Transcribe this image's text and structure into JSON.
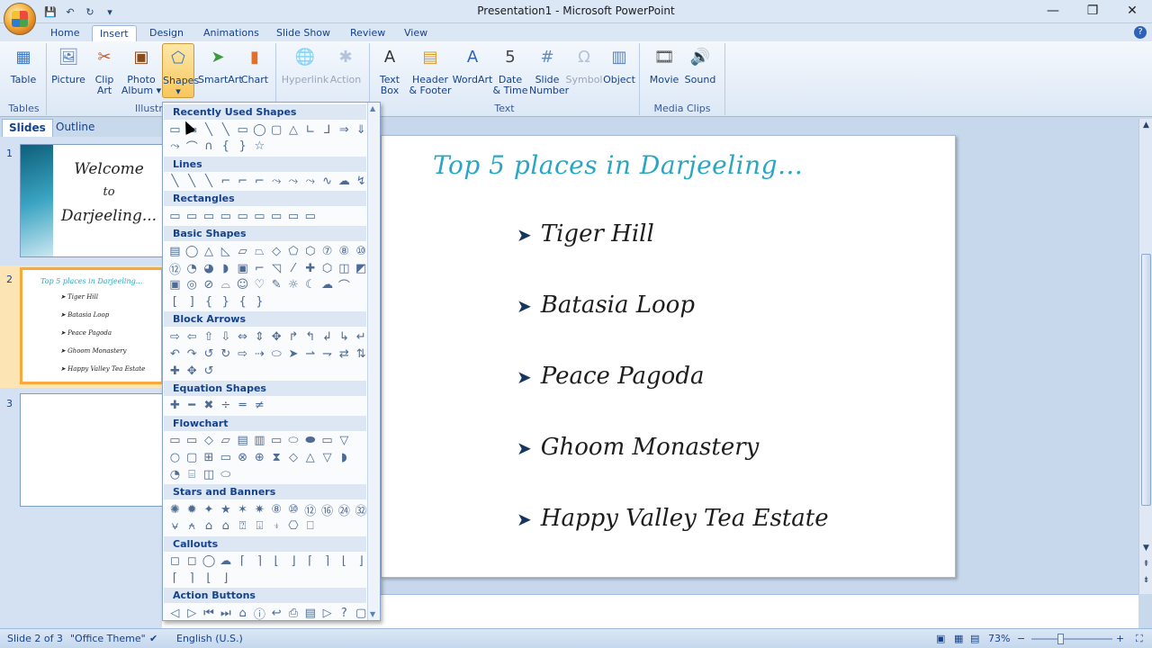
{
  "window": {
    "title": "Presentation1 - Microsoft PowerPoint",
    "minimize": "—",
    "restore": "❐",
    "close": "✕"
  },
  "qat": {
    "save": "💾",
    "undo": "↶",
    "redo": "↻",
    "more": "▾"
  },
  "tabs": [
    "Home",
    "Insert",
    "Design",
    "Animations",
    "Slide Show",
    "Review",
    "View"
  ],
  "active_tab": "Insert",
  "help_icon": "?",
  "ribbon": {
    "groups": [
      {
        "label": "Tables"
      },
      {
        "label": "Illustrations"
      },
      {
        "label": "Text"
      },
      {
        "label": "Media Clips"
      }
    ],
    "buttons": [
      {
        "line1": "Table",
        "line2": "",
        "icon": "▦",
        "color": "#3a78c8",
        "state": "normal"
      },
      {
        "line1": "Picture",
        "line2": "",
        "icon": "🖼",
        "color": "#5b7fb7",
        "state": "normal"
      },
      {
        "line1": "Clip",
        "line2": "Art",
        "icon": "✂",
        "color": "#c65a2a",
        "state": "normal"
      },
      {
        "line1": "Photo",
        "line2": "Album ▾",
        "icon": "▣",
        "color": "#8a4a1a",
        "state": "normal"
      },
      {
        "line1": "Shapes",
        "line2": "▾",
        "icon": "⬠",
        "color": "#3a78c8",
        "state": "pressed"
      },
      {
        "line1": "SmartArt",
        "line2": "",
        "icon": "➤",
        "color": "#3d9a3d",
        "state": "normal"
      },
      {
        "line1": "Chart",
        "line2": "",
        "icon": "▮",
        "color": "#e0702a",
        "state": "normal"
      },
      {
        "line1": "Hyperlink",
        "line2": "",
        "icon": "🌐",
        "color": "#6a88b4",
        "state": "disabled"
      },
      {
        "line1": "Action",
        "line2": "",
        "icon": "✱",
        "color": "#6a88b4",
        "state": "disabled"
      },
      {
        "line1": "Text",
        "line2": "Box",
        "icon": "A",
        "color": "#333333",
        "state": "normal"
      },
      {
        "line1": "Header",
        "line2": "& Footer",
        "icon": "▤",
        "color": "#d79a2a",
        "state": "normal"
      },
      {
        "line1": "WordArt",
        "line2": "",
        "icon": "A",
        "color": "#2f62b6",
        "state": "normal"
      },
      {
        "line1": "Date",
        "line2": "& Time",
        "icon": "5",
        "color": "#444444",
        "state": "normal"
      },
      {
        "line1": "Slide",
        "line2": "Number",
        "icon": "#",
        "color": "#6a88b4",
        "state": "normal"
      },
      {
        "line1": "Symbol",
        "line2": "",
        "icon": "Ω",
        "color": "#6a88b4",
        "state": "disabled"
      },
      {
        "line1": "Object",
        "line2": "",
        "icon": "▥",
        "color": "#5b7fb7",
        "state": "normal"
      },
      {
        "line1": "Movie",
        "line2": "",
        "icon": "🎞",
        "color": "#555555",
        "state": "normal"
      },
      {
        "line1": "Sound",
        "line2": "",
        "icon": "🔊",
        "color": "#d79a2a",
        "state": "normal"
      }
    ]
  },
  "side_tabs": [
    "Slides",
    "Outline"
  ],
  "thumbnails": {
    "numbers": [
      "1",
      "2",
      "3"
    ],
    "slide1": [
      "Welcome",
      "to",
      "Darjeeling..."
    ],
    "slide2_title": "Top 5 places in Darjeeling...",
    "slide2_items": [
      "Tiger Hill",
      "Batasia Loop",
      "Peace Pagoda",
      "Ghoom Monastery",
      "Happy Valley Tea Estate"
    ]
  },
  "slide": {
    "title": "Top 5 places in Darjeeling...",
    "bullets": [
      "Tiger Hill",
      "Batasia Loop",
      "Peace Pagoda",
      "Ghoom Monastery",
      "Happy Valley Tea Estate"
    ],
    "bullet_icon": "➤"
  },
  "gallery": {
    "sections": [
      {
        "name": "Recently Used Shapes",
        "rows": [
          [
            "▭",
            "▭",
            "╲",
            "╲",
            "▭",
            "◯",
            "▢",
            "△",
            "∟",
            "⅃",
            "⇒",
            "⇓",
            "☁"
          ],
          [
            "⤳",
            "⌒",
            "∩",
            "{",
            "}",
            "☆"
          ]
        ]
      },
      {
        "name": "Lines",
        "rows": [
          [
            "╲",
            "╲",
            "╲",
            "⌐",
            "⌐",
            "⌐",
            "⤳",
            "⤳",
            "⤳",
            "∿",
            "☁",
            "↯"
          ]
        ]
      },
      {
        "name": "Rectangles",
        "rows": [
          [
            "▭",
            "▭",
            "▭",
            "▭",
            "▭",
            "▭",
            "▭",
            "▭",
            "▭"
          ]
        ]
      },
      {
        "name": "Basic Shapes",
        "rows": [
          [
            "▤",
            "◯",
            "△",
            "◺",
            "▱",
            "⏢",
            "◇",
            "⬠",
            "⬡",
            "⑦",
            "⑧",
            "⑩"
          ],
          [
            "⑫",
            "◔",
            "◕",
            "◗",
            "▣",
            "⌐",
            "◹",
            "⁄",
            "✚",
            "⬡",
            "◫",
            "◩"
          ],
          [
            "▣",
            "◎",
            "⊘",
            "⌓",
            "☺",
            "♡",
            "✎",
            "☼",
            "☾",
            "☁",
            "⌒"
          ],
          [
            "[",
            "]",
            "{",
            "}",
            "{",
            "}"
          ]
        ]
      },
      {
        "name": "Block Arrows",
        "rows": [
          [
            "⇨",
            "⇦",
            "⇧",
            "⇩",
            "⇔",
            "⇕",
            "✥",
            "↱",
            "↰",
            "↲",
            "↳",
            "↵"
          ],
          [
            "↶",
            "↷",
            "↺",
            "↻",
            "⇨",
            "⇢",
            "⬭",
            "➤",
            "⇀",
            "⇁",
            "⇄",
            "⇅"
          ],
          [
            "✚",
            "✥",
            "↺"
          ]
        ]
      },
      {
        "name": "Equation Shapes",
        "rows": [
          [
            "✚",
            "━",
            "✖",
            "÷",
            "═",
            "≠"
          ]
        ]
      },
      {
        "name": "Flowchart",
        "rows": [
          [
            "▭",
            "▭",
            "◇",
            "▱",
            "▤",
            "▥",
            "▭",
            "⬭",
            "⬬",
            "▭",
            "▽"
          ],
          [
            "○",
            "▢",
            "⊞",
            "▭",
            "⊗",
            "⊕",
            "⧗",
            "◇",
            "△",
            "▽",
            "◗"
          ],
          [
            "◔",
            "⌸",
            "◫",
            "⬭"
          ]
        ]
      },
      {
        "name": "Stars and Banners",
        "rows": [
          [
            "✺",
            "✹",
            "✦",
            "★",
            "✶",
            "✷",
            "⑧",
            "⑩",
            "⑫",
            "⑯",
            "㉔",
            "㉜"
          ],
          [
            "⍱",
            "⍲",
            "⌂",
            "⌂",
            "⍰",
            "⍗",
            "⍖",
            "⎔",
            "⎕"
          ]
        ]
      },
      {
        "name": "Callouts",
        "rows": [
          [
            "◻",
            "◻",
            "◯",
            "☁",
            "⌈",
            "⌉",
            "⌊",
            "⌋",
            "⌈",
            "⌉",
            "⌊",
            "⌋"
          ],
          [
            "⌈",
            "⌉",
            "⌊",
            "⌋"
          ]
        ]
      },
      {
        "name": "Action Buttons",
        "rows": [
          [
            "◁",
            "▷",
            "⏮",
            "⏭",
            "⌂",
            "ⓘ",
            "↩",
            "⎙",
            "▤",
            "▷",
            "?",
            "▢"
          ]
        ]
      }
    ]
  },
  "status": {
    "slide": "Slide 2 of 3",
    "theme": "\"Office Theme\"",
    "language": "English (U.S.)",
    "zoom": "73%",
    "zoom_minus": "−",
    "zoom_plus": "+"
  },
  "scroll": {
    "up": "▲",
    "down": "▼",
    "prev": "⇞",
    "next": "⇟"
  }
}
